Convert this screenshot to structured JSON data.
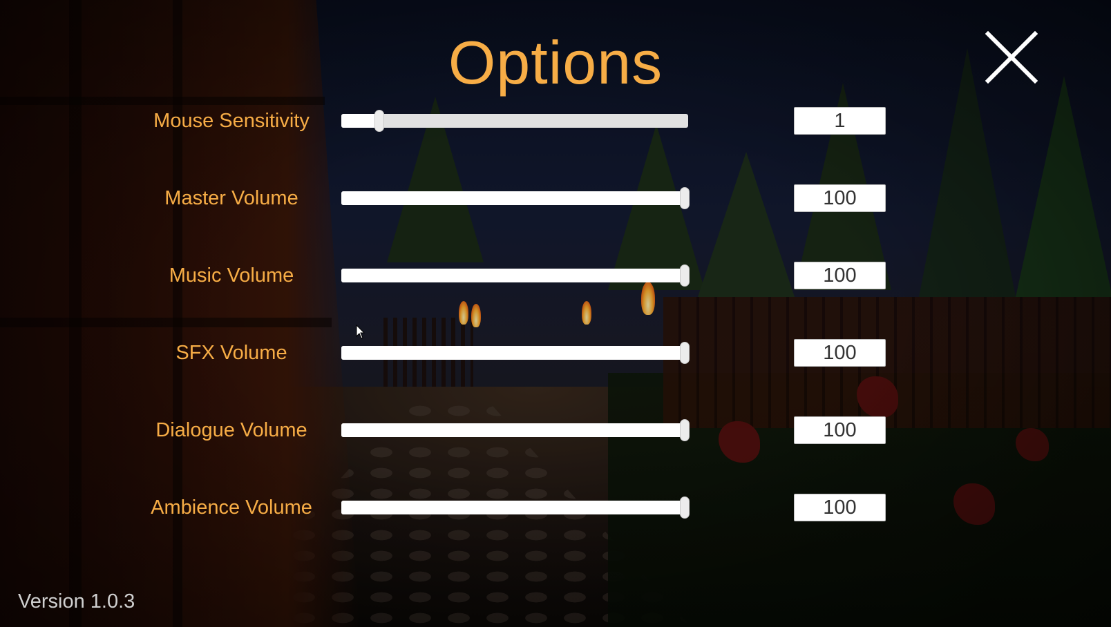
{
  "title": "Options",
  "close_icon": "close-x-icon",
  "accent_color": "#f7ad46",
  "settings": [
    {
      "label": "Mouse Sensitivity",
      "value": "1",
      "fraction": 0.11
    },
    {
      "label": "Master Volume",
      "value": "100",
      "fraction": 1.0
    },
    {
      "label": "Music Volume",
      "value": "100",
      "fraction": 1.0
    },
    {
      "label": "SFX Volume",
      "value": "100",
      "fraction": 1.0
    },
    {
      "label": "Dialogue Volume",
      "value": "100",
      "fraction": 1.0
    },
    {
      "label": "Ambience Volume",
      "value": "100",
      "fraction": 1.0
    }
  ],
  "version": "Version 1.0.3"
}
